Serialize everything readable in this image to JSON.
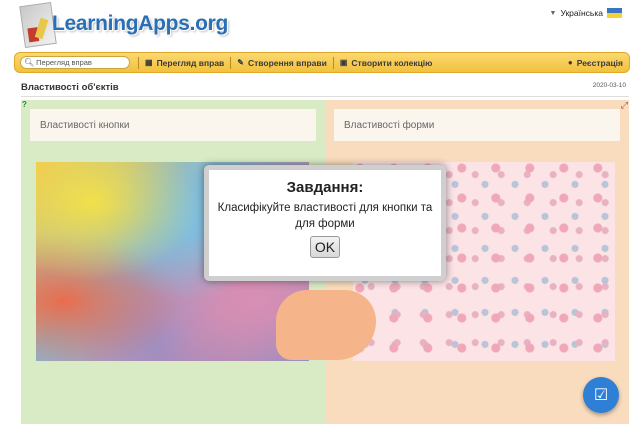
{
  "header": {
    "logo_text": "LearningApps.org",
    "language": "Українська"
  },
  "nav": {
    "search_placeholder": "Перегляд вправ",
    "browse": "Перегляд вправ",
    "create": "Створення вправи",
    "collection": "Створити колекцію",
    "register": "Реєстрація"
  },
  "page": {
    "title": "Властивості об'єктів",
    "date": "2020-03-10"
  },
  "app": {
    "bucket_left": "Властивості кнопки",
    "bucket_right": "Властивості форми"
  },
  "modal": {
    "title": "Завдання:",
    "text": "Класифікуйте властивості для кнопки та для форми",
    "ok": "OK"
  },
  "colors": {
    "nav_bar": "#f2c13d",
    "left_zone": "#d9ebc5",
    "right_zone": "#f9dcbd",
    "check_button": "#2f7fd6",
    "logo": "#2a6fb5"
  },
  "icons": [
    "search-icon",
    "grid-icon",
    "pencil-icon",
    "collection-icon",
    "user-icon",
    "help-icon",
    "fullscreen-icon",
    "check-icon"
  ]
}
